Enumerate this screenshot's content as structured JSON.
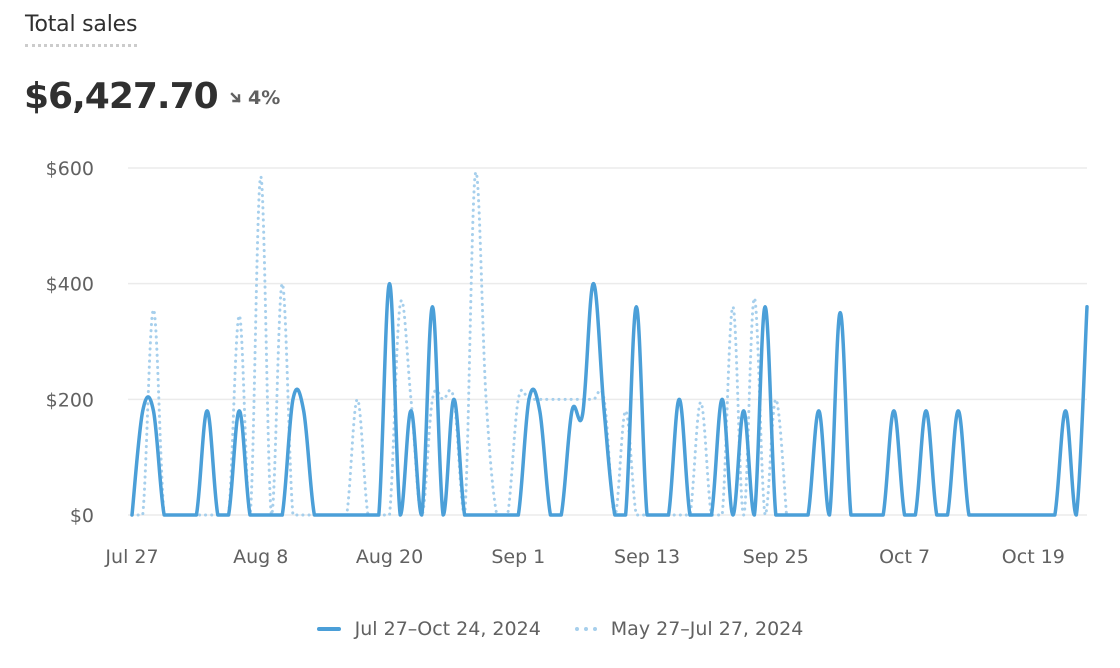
{
  "header": {
    "title": "Total sales",
    "total_value": "$6,427.70",
    "delta_icon": "arrow-down-right-icon",
    "delta_value": "4%"
  },
  "legend": {
    "current_label": "Jul 27–Oct 24, 2024",
    "previous_label": "May 27–Jul 27, 2024"
  },
  "colors": {
    "current": "#4b9fd8",
    "previous": "#a6cfec",
    "grid": "#ebebeb",
    "axis_text": "#616161"
  },
  "chart_data": {
    "type": "line",
    "title": "Total sales",
    "xlabel": "",
    "ylabel": "",
    "ylim": [
      0,
      600
    ],
    "yticks": [
      0,
      200,
      400,
      600
    ],
    "ytick_labels": [
      "$0",
      "$200",
      "$400",
      "$600"
    ],
    "x_day_count": 90,
    "xticks_day_index": [
      0,
      12,
      24,
      36,
      48,
      60,
      72,
      84
    ],
    "xtick_labels": [
      "Jul 27",
      "Aug 8",
      "Aug 20",
      "Sep 1",
      "Sep 13",
      "Sep 25",
      "Oct 7",
      "Oct 19"
    ],
    "grid": true,
    "legend_position": "bottom-center",
    "series": [
      {
        "name": "Jul 27–Oct 24, 2024",
        "style": "solid",
        "values": [
          0,
          180,
          180,
          0,
          0,
          0,
          0,
          180,
          0,
          0,
          180,
          0,
          0,
          0,
          0,
          200,
          180,
          0,
          0,
          0,
          0,
          0,
          0,
          0,
          400,
          0,
          180,
          0,
          360,
          0,
          200,
          0,
          0,
          0,
          0,
          0,
          0,
          200,
          180,
          0,
          0,
          180,
          175,
          400,
          180,
          0,
          0,
          360,
          0,
          0,
          0,
          200,
          0,
          0,
          0,
          200,
          0,
          180,
          0,
          360,
          0,
          0,
          0,
          0,
          180,
          0,
          350,
          0,
          0,
          0,
          0,
          180,
          0,
          0,
          180,
          0,
          0,
          180,
          0,
          0,
          0,
          0,
          0,
          0,
          0,
          0,
          0,
          180,
          0,
          360
        ]
      },
      {
        "name": "May 27–Jul 27, 2024",
        "style": "dotted",
        "values": [
          0,
          0,
          355,
          0,
          0,
          0,
          0,
          0,
          0,
          0,
          345,
          0,
          585,
          0,
          400,
          0,
          0,
          0,
          0,
          0,
          0,
          200,
          0,
          0,
          0,
          365,
          200,
          0,
          200,
          200,
          200,
          0,
          590,
          200,
          0,
          0,
          200,
          200,
          200,
          200,
          200,
          200,
          200,
          200,
          200,
          0,
          180,
          0,
          0,
          0,
          0,
          0,
          0,
          195,
          0,
          0,
          360,
          0,
          375,
          0,
          200,
          0
        ]
      }
    ]
  }
}
